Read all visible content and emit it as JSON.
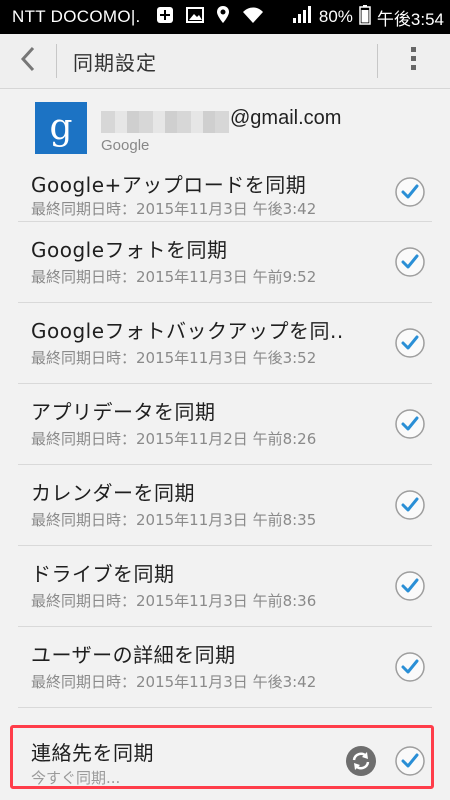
{
  "status_bar": {
    "carrier": "NTT DOCOMO|.",
    "battery": "80%",
    "time": "午後3:54",
    "icons": [
      "plus-badge-icon",
      "image-icon",
      "location-icon",
      "wifi-icon",
      "signal-icon",
      "battery-icon"
    ]
  },
  "action_bar": {
    "title": "同期設定",
    "back_icon": "chevron-left-icon",
    "menu_icon": "overflow-menu-icon"
  },
  "account": {
    "email_suffix": "@gmail.com",
    "type": "Google",
    "logo_letter": "g",
    "colors": {
      "logo_bg": "#1c73c4"
    }
  },
  "sync_items": [
    {
      "title": "Google+アップロードを同期",
      "subtitle": "最終同期日時：2015年11月3日 午後3:42",
      "checked": true
    },
    {
      "title": "Googleフォトを同期",
      "subtitle": "最終同期日時：2015年11月3日 午前9:52",
      "checked": true
    },
    {
      "title": "Googleフォトバックアップを同..",
      "subtitle": "最終同期日時：2015年11月3日 午後3:52",
      "checked": true
    },
    {
      "title": "アプリデータを同期",
      "subtitle": "最終同期日時：2015年11月2日 午前8:26",
      "checked": true
    },
    {
      "title": "カレンダーを同期",
      "subtitle": "最終同期日時：2015年11月3日 午前8:35",
      "checked": true
    },
    {
      "title": "ドライブを同期",
      "subtitle": "最終同期日時：2015年11月3日 午前8:36",
      "checked": true
    },
    {
      "title": "ユーザーの詳細を同期",
      "subtitle": "最終同期日時：2015年11月3日 午後3:42",
      "checked": true
    },
    {
      "title": "連絡先を同期",
      "subtitle": "今すぐ同期...",
      "checked": true,
      "syncing": true
    }
  ],
  "colors": {
    "check_stroke": "#2a8fd6",
    "highlight": "#ff3d4a",
    "background": "#f2f2f2"
  }
}
